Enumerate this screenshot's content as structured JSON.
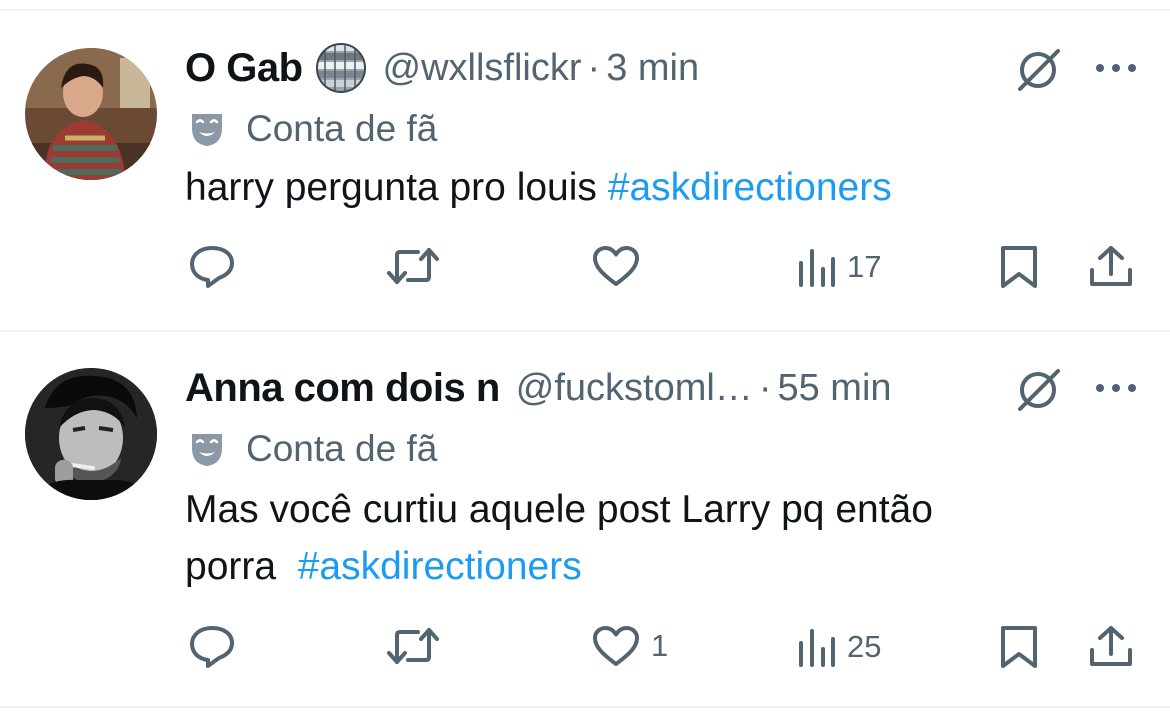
{
  "tweets": [
    {
      "name": "O Gab",
      "handle": "@wxllsflickr",
      "separator": "·",
      "time": "3 min",
      "badge_icon": "theater-mask-icon",
      "badge": "Conta de fã",
      "text_lines": [
        {
          "plain": "harry pergunta pro louis ",
          "hashtag": "#askdirectioners"
        }
      ],
      "actions": {
        "reply_count": "",
        "retweet_count": "",
        "like_count": "",
        "views_count": "17"
      }
    },
    {
      "name": "Anna com dois n",
      "handle": "@fuckstoml…",
      "separator": "·",
      "time": "55 min",
      "badge_icon": "theater-mask-icon",
      "badge": "Conta de fã",
      "text_lines": [
        {
          "plain": "Mas você curtiu aquele post Larry pq então",
          "hashtag": ""
        },
        {
          "plain": "porra  ",
          "hashtag": "#askdirectioners"
        }
      ],
      "actions": {
        "reply_count": "",
        "retweet_count": "",
        "like_count": "1",
        "views_count": "25"
      }
    }
  ],
  "colors": {
    "text": "#0f1419",
    "secondary": "#536471",
    "hashtag": "#1d9bf0",
    "divider": "#eff3f4"
  }
}
